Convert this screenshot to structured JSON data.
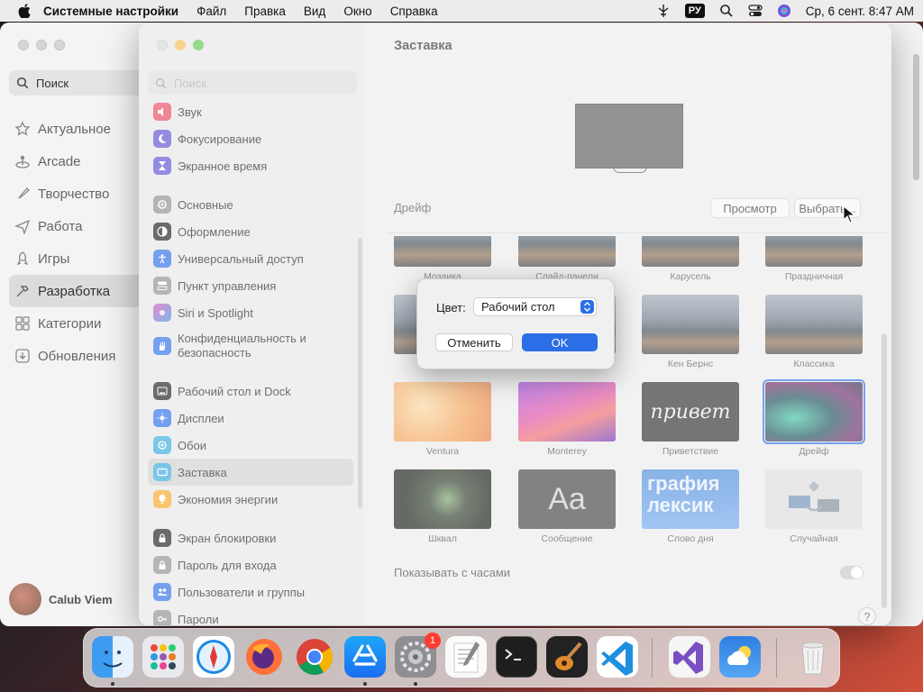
{
  "menubar": {
    "app_name": "Системные настройки",
    "items": [
      "Файл",
      "Правка",
      "Вид",
      "Окно",
      "Справка"
    ],
    "input_source": "РУ",
    "datetime": "Ср, 6 сент.  8:47 AM"
  },
  "appstore": {
    "search_label": "Поиск",
    "nav": [
      "Актуальное",
      "Arcade",
      "Творчество",
      "Работа",
      "Игры",
      "Разработка",
      "Категории",
      "Обновления"
    ],
    "selected_nav": "Разработка",
    "user_name": "Calub Viem"
  },
  "settings": {
    "search_placeholder": "Поиск",
    "sidebar": [
      {
        "label": "Звук",
        "icon": "speaker-icon",
        "color": "#e8475f"
      },
      {
        "label": "Фокусирование",
        "icon": "moon-icon",
        "color": "#5a4fcf"
      },
      {
        "label": "Экранное время",
        "icon": "hourglass-icon",
        "color": "#5a4fcf"
      },
      {
        "label": "Основные",
        "icon": "gear-icon",
        "color": "#8e8e93"
      },
      {
        "label": "Оформление",
        "icon": "appearance-icon",
        "color": "#1c1c1e"
      },
      {
        "label": "Универсальный доступ",
        "icon": "accessibility-icon",
        "color": "#2b6ee6"
      },
      {
        "label": "Пункт управления",
        "icon": "control-center-icon",
        "color": "#8e8e93"
      },
      {
        "label": "Siri и Spotlight",
        "icon": "siri-icon",
        "color": "#6a3fb5"
      },
      {
        "label": "Конфиденциальность и безопасность",
        "icon": "hand-icon",
        "color": "#2b6ee6"
      },
      {
        "label": "Рабочий стол и Dock",
        "icon": "desktop-icon",
        "color": "#1c1c1e"
      },
      {
        "label": "Дисплеи",
        "icon": "sun-icon",
        "color": "#2b6ee6"
      },
      {
        "label": "Обои",
        "icon": "wallpaper-icon",
        "color": "#34aadc"
      },
      {
        "label": "Заставка",
        "icon": "screensaver-icon",
        "color": "#34aadc"
      },
      {
        "label": "Экономия энергии",
        "icon": "bulb-icon",
        "color": "#f5a623"
      },
      {
        "label": "Экран блокировки",
        "icon": "lock-icon",
        "color": "#1c1c1e"
      },
      {
        "label": "Пароль для входа",
        "icon": "password-icon",
        "color": "#8e8e93"
      },
      {
        "label": "Пользователи и группы",
        "icon": "users-icon",
        "color": "#2b6ee6"
      },
      {
        "label": "Пароли",
        "icon": "key-icon",
        "color": "#8e8e93"
      }
    ],
    "selected": "Заставка",
    "title": "Заставка",
    "current_saver": "Дрейф",
    "preview_button": "Просмотр",
    "options_button": "Выбрать...",
    "tiles": [
      {
        "label": "Мозаика"
      },
      {
        "label": "Слайд-панели"
      },
      {
        "label": "Карусель"
      },
      {
        "label": "Праздничная"
      },
      {
        "label": ""
      },
      {
        "label": ""
      },
      {
        "label": "Кен Бернс"
      },
      {
        "label": "Классика"
      },
      {
        "label": "Ventura"
      },
      {
        "label": "Monterey"
      },
      {
        "label": "Приветствие",
        "text": "привет"
      },
      {
        "label": "Дрейф"
      },
      {
        "label": "Шквал"
      },
      {
        "label": "Сообщение",
        "text": "Aa"
      },
      {
        "label": "Слово дня",
        "text": "графия лексик"
      },
      {
        "label": "Случайная"
      }
    ],
    "show_with_clock": "Показывать с часами",
    "show_with_clock_on": false,
    "help": "?"
  },
  "sheet": {
    "color_label": "Цвет:",
    "color_value": "Рабочий стол",
    "cancel": "Отменить",
    "ok": "OK"
  },
  "dock": {
    "apps": [
      "finder-icon",
      "launchpad-icon",
      "safari-icon",
      "firefox-icon",
      "chrome-icon",
      "app-store-icon",
      "system-settings-icon",
      "textedit-icon",
      "terminal-icon",
      "garageband-icon",
      "vscode-icon",
      "visual-studio-icon",
      "weather-icon",
      "trash-icon"
    ],
    "badge": "1"
  }
}
